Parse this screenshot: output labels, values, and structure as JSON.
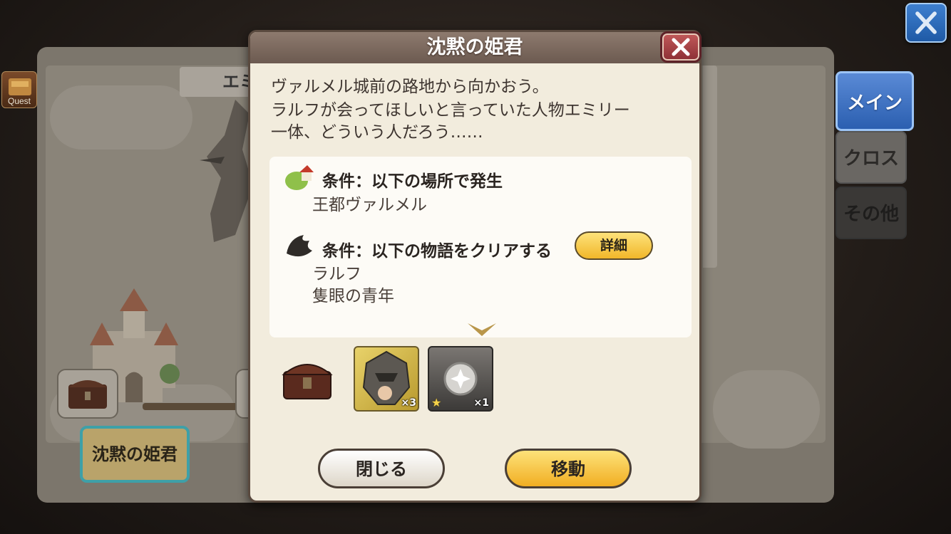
{
  "screen": {
    "top_close_icon": "close-x-icon"
  },
  "sidebar": {
    "quest_label": "Quest",
    "tabs": [
      {
        "label": "メイン",
        "active": true
      },
      {
        "label": "クロス",
        "active": false
      },
      {
        "label": "その他",
        "active": false
      }
    ]
  },
  "background": {
    "partial_title": "エミ",
    "stage_label": "沈黙の姫君"
  },
  "dialog": {
    "title": "沈黙の姫君",
    "description": [
      "ヴァルメル城前の路地から向かおう。",
      "ラルフが会ってほしいと言っていた人物エミリー",
      "一体、どういう人だろう……"
    ],
    "conditions": [
      {
        "icon": "location-house-icon",
        "title": "条件：以下の場所で発生",
        "details": [
          "王都ヴァルメル"
        ]
      },
      {
        "icon": "story-raven-icon",
        "title": "条件：以下の物語をクリアする",
        "details": [
          "ラルフ",
          "隻眼の青年"
        ],
        "detail_button": "詳細"
      }
    ],
    "rewards": [
      {
        "icon": "knight-helmet-icon",
        "qty": "×3"
      },
      {
        "icon": "silver-orb-icon",
        "qty": "×1",
        "rarity": "★"
      }
    ],
    "buttons": {
      "close": "閉じる",
      "move": "移動"
    },
    "colors": {
      "header": "#7a675c",
      "panel": "#f2ecdd",
      "accent_yellow": "#f5c23a",
      "tab_blue": "#3d73c4"
    }
  }
}
